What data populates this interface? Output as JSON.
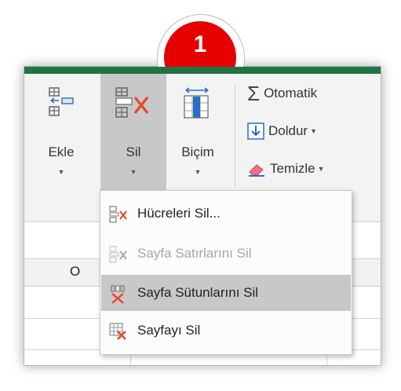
{
  "step_badge": {
    "number": "1",
    "color": "#e60000"
  },
  "accent_color": "#217346",
  "ribbon": {
    "ekle": {
      "label": "Ekle",
      "icon": "insert-cells-icon"
    },
    "sil": {
      "label": "Sil",
      "icon": "delete-cells-icon"
    },
    "bicim": {
      "label": "Biçim",
      "icon": "format-icon"
    },
    "otomatik": {
      "label": "Otomatik",
      "icon": "sigma-autosum-icon"
    },
    "doldur": {
      "label": "Doldur",
      "icon": "fill-down-icon"
    },
    "temizle": {
      "label": "Temizle",
      "icon": "eraser-icon"
    }
  },
  "grid": {
    "column_header": "O"
  },
  "menu": {
    "items": [
      {
        "label": "Hücreleri Sil...",
        "icon": "delete-cells-icon",
        "state": "enabled"
      },
      {
        "label": "Sayfa Satırlarını Sil",
        "icon": "delete-rows-icon",
        "state": "disabled"
      },
      {
        "label": "Sayfa Sütunlarını Sil",
        "icon": "delete-columns-icon",
        "state": "hovered"
      },
      {
        "label": "Sayfayı Sil",
        "icon": "delete-sheet-icon",
        "state": "enabled"
      }
    ]
  }
}
